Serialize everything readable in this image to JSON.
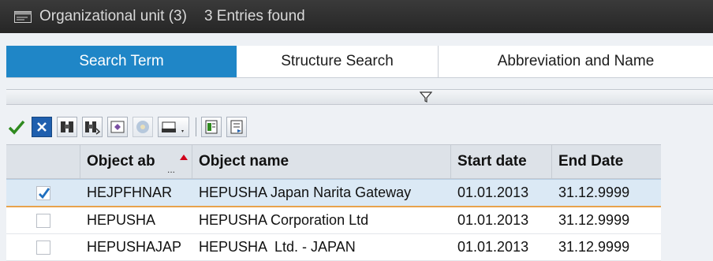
{
  "window": {
    "title": "Organizational unit (3)",
    "entries_found": "3 Entries found"
  },
  "tabs": [
    {
      "label": "Search Term",
      "active": true
    },
    {
      "label": "Structure Search",
      "active": false
    },
    {
      "label": "Abbreviation and Name",
      "active": false
    }
  ],
  "toolbar": {
    "buttons": [
      "checkmark-icon",
      "cancel-icon",
      "find-icon",
      "find-next-icon",
      "settings-icon",
      "info-icon",
      "print-icon",
      "export-icon",
      "export-alt-icon"
    ]
  },
  "table": {
    "columns": [
      "Object ab",
      "Object name",
      "Start date",
      "End Date"
    ],
    "truncated_marker": "...",
    "rows": [
      {
        "selected": true,
        "abbr": "HEJPFHNAR",
        "name": "HEPUSHA Japan Narita Gateway",
        "start": "01.01.2013",
        "end": "31.12.9999"
      },
      {
        "selected": false,
        "abbr": "HEPUSHA",
        "name": "HEPUSHA Corporation Ltd",
        "start": "01.01.2013",
        "end": "31.12.9999"
      },
      {
        "selected": false,
        "abbr": "HEPUSHAJAP",
        "name": "HEPUSHA  Ltd. - JAPAN",
        "start": "01.01.2013",
        "end": "31.12.9999"
      }
    ]
  },
  "colors": {
    "accent": "#1f86c7",
    "title_bar": "#2e2e2e",
    "selected_row": "#dbe9f5",
    "selection_line": "#e8a34c"
  }
}
